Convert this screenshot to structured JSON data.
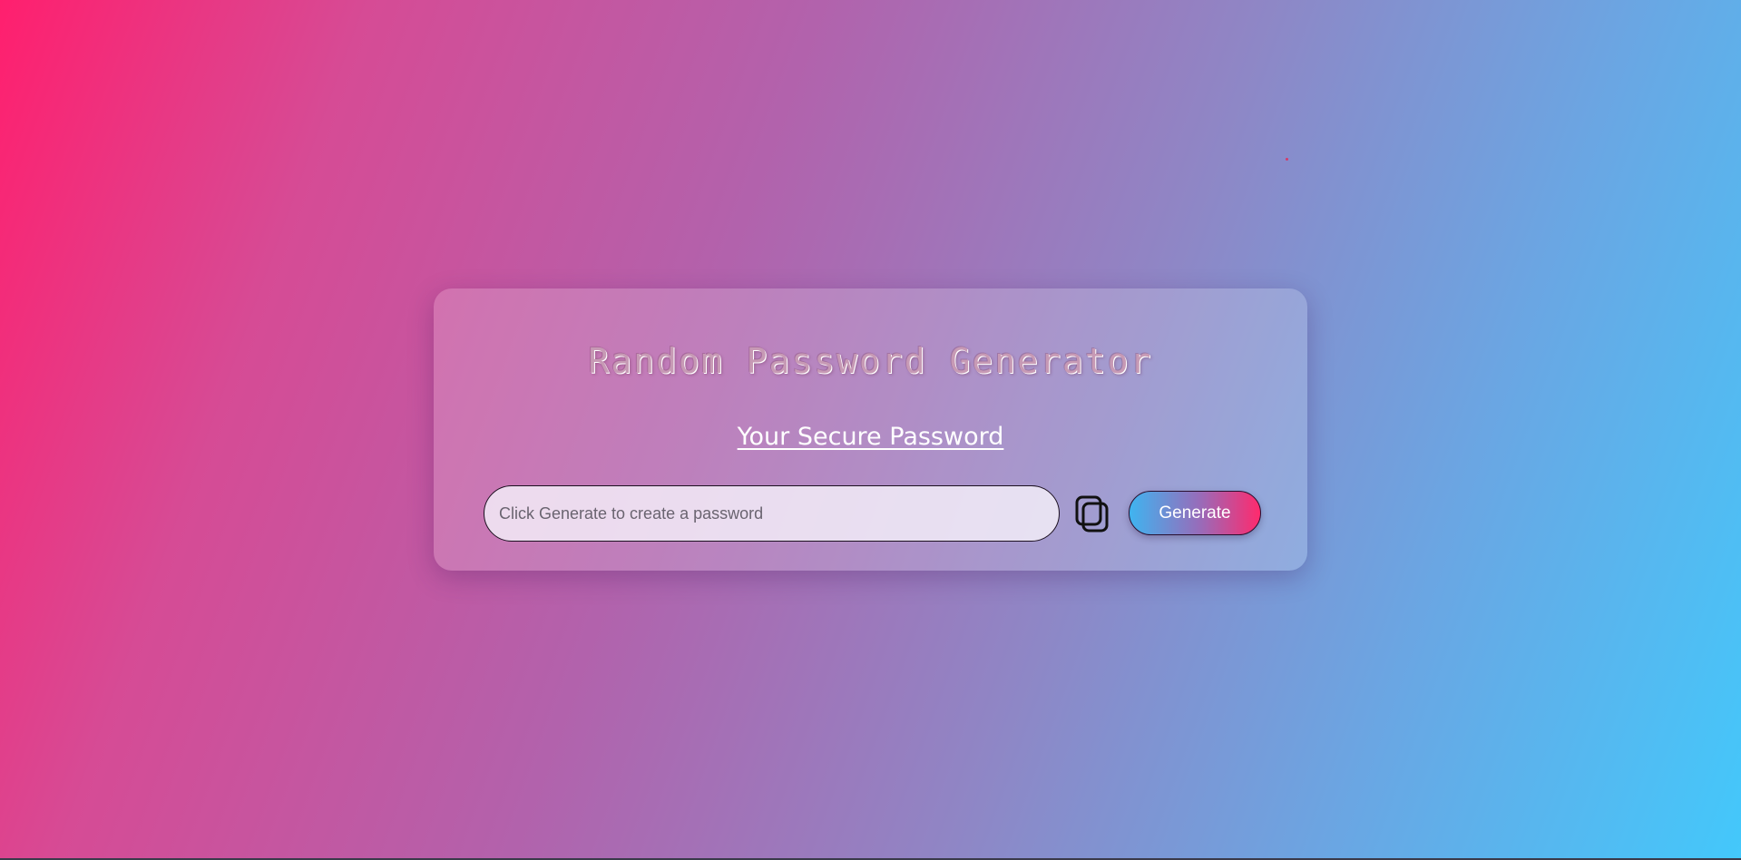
{
  "card": {
    "title": "Random Password Generator",
    "subtitle": "Your Secure Password"
  },
  "password_field": {
    "value": "",
    "placeholder": "Click Generate to create a password"
  },
  "copy_button": {
    "icon": "copy-icon"
  },
  "generate_button": {
    "label": "Generate"
  },
  "colors": {
    "gradient_start": "#ff1f6e",
    "gradient_end": "#43c8fb",
    "button_gradient_start": "#3fb4f0",
    "button_gradient_end": "#ff2a6d",
    "title_text": "#c79ab5",
    "subtitle_text": "#ffffff"
  }
}
